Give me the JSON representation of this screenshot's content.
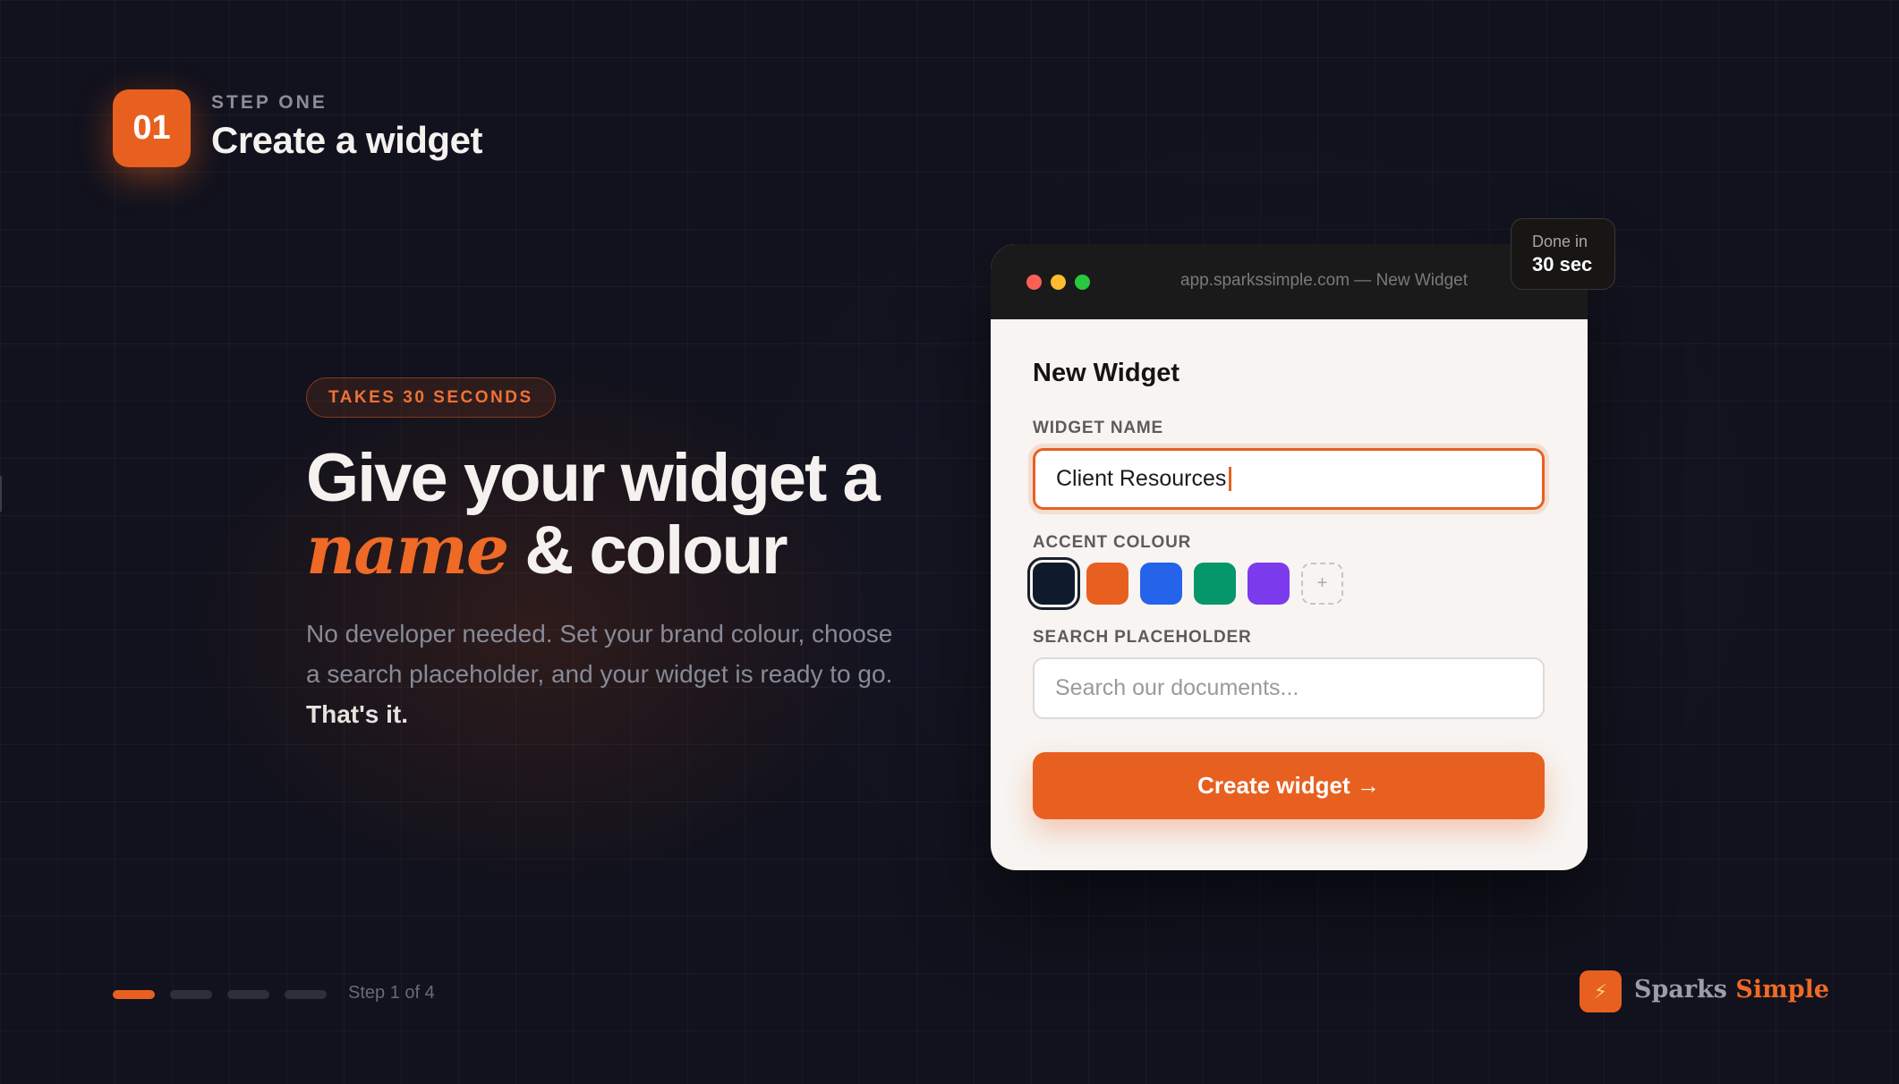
{
  "step": {
    "number": "01",
    "kicker": "STEP ONE",
    "title": "Create a widget"
  },
  "hero": {
    "pill": "TAKES 30 SECONDS",
    "headline_line1": "Give your widget a",
    "headline_accent": "name",
    "headline_line2_rest": " & colour",
    "body": "No developer needed. Set your brand colour, choose a search placeholder, and your widget is ready to go.",
    "body_strong": "That's it."
  },
  "window": {
    "url": "app.sparkssimple.com — New Widget",
    "form_title": "New Widget",
    "widget_name_label": "WIDGET NAME",
    "widget_name_value": "Client Resources",
    "accent_label": "ACCENT COLOUR",
    "swatches": [
      "#0f1a2c",
      "#e8601f",
      "#2563eb",
      "#059669",
      "#7c3aed"
    ],
    "swatch_add": "+",
    "placeholder_label": "SEARCH PLACEHOLDER",
    "placeholder_value": "Search our documents...",
    "cta_label": "Create widget →"
  },
  "done_chip": {
    "line1": "Done in",
    "line2": "30 sec"
  },
  "progress": {
    "current": 1,
    "total": 4,
    "label": "Step 1 of 4"
  },
  "brand": {
    "icon": "lightning-icon",
    "name_part1": "Sparks",
    "name_part2": "Simple"
  },
  "colors": {
    "accent": "#e8601f",
    "background": "#11121d",
    "card": "#f7f4f1"
  }
}
